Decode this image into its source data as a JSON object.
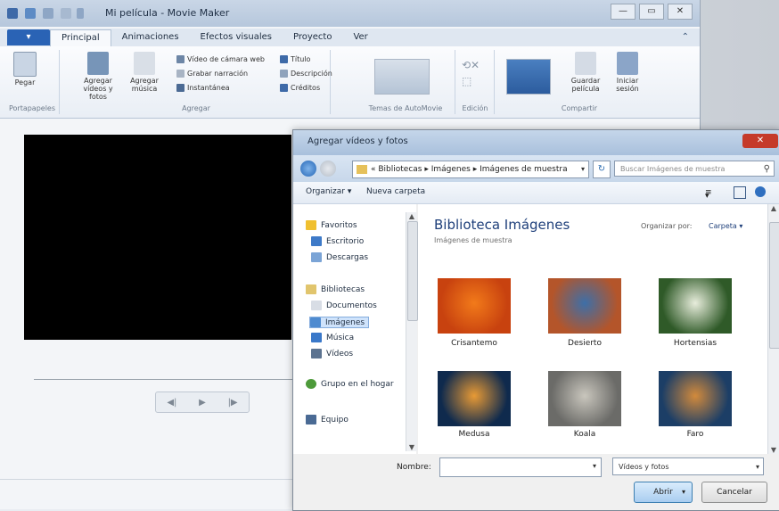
{
  "app": {
    "title": "Mi película - Movie Maker",
    "window_controls": [
      "—",
      "▭",
      "✕"
    ]
  },
  "ribbon": {
    "file_tab": "▾",
    "tabs": [
      "Principal",
      "Animaciones",
      "Efectos visuales",
      "Proyecto",
      "Ver"
    ],
    "minimize_icon": "⌃",
    "groups": {
      "clipboard": {
        "paste": "Pegar",
        "label": "Portapapeles"
      },
      "add": {
        "add_videos": "Agregar vídeos y fotos",
        "add_music": "Agregar música",
        "webcam": "Vídeo de cámara web",
        "narration": "Grabar narración",
        "snapshot": "Instantánea",
        "title": "Título",
        "caption": "Descripción",
        "credits": "Créditos",
        "label": "Agregar"
      },
      "themes": {
        "label": "Temas de AutoMovie"
      },
      "editing": {
        "label": "Edición"
      },
      "share": {
        "save_movie": "Guardar película",
        "sign_in": "Iniciar sesión",
        "label": "Compartir"
      }
    }
  },
  "player": {
    "prev": "◀|",
    "play": "▶",
    "next": "|▶"
  },
  "dialog": {
    "title": "Agregar vídeos y fotos",
    "close": "✕",
    "address": {
      "segments": [
        "Bibliotecas",
        "Imágenes",
        "Imágenes de muestra"
      ],
      "display": "« Bibliotecas ▸ Imágenes ▸ Imágenes de muestra",
      "dropdown": "▾"
    },
    "refresh": "↻",
    "search_placeholder": "Buscar Imágenes de muestra",
    "toolbar": {
      "organize": "Organizar ▾",
      "new_folder": "Nueva carpeta"
    },
    "nav": {
      "favorites": "Favoritos",
      "desktop": "Escritorio",
      "downloads": "Descargas",
      "libraries": "Bibliotecas",
      "documents": "Documentos",
      "images": "Imágenes",
      "music": "Música",
      "videos": "Vídeos",
      "homegroup": "Grupo en el hogar",
      "computer": "Equipo"
    },
    "content": {
      "library_title": "Biblioteca Imágenes",
      "library_subtitle": "Imágenes de muestra",
      "arrange_label": "Organizar por:",
      "arrange_value": "Carpeta ▾",
      "items": [
        {
          "label": "Crisantemo",
          "color_a": "#c8420f",
          "color_b": "#f27a1a"
        },
        {
          "label": "Desierto",
          "color_a": "#b4552a",
          "color_b": "#3d6fa8"
        },
        {
          "label": "Hortensias",
          "color_a": "#2f5a28",
          "color_b": "#e8eddc"
        },
        {
          "label": "Medusa",
          "color_a": "#0f2a4d",
          "color_b": "#e89a35"
        },
        {
          "label": "Koala",
          "color_a": "#6b6b68",
          "color_b": "#c9c6bd"
        },
        {
          "label": "Faro",
          "color_a": "#1c3e66",
          "color_b": "#d28a3c"
        }
      ]
    },
    "filename_label": "Nombre:",
    "filename_value": "",
    "filter": "Vídeos y fotos",
    "open": "Abrir",
    "cancel": "Cancelar"
  },
  "colors": {
    "ribbon_accent": "#2a63b5",
    "dialog_close": "#c53a2a",
    "open_button": "#a9cdf0"
  }
}
